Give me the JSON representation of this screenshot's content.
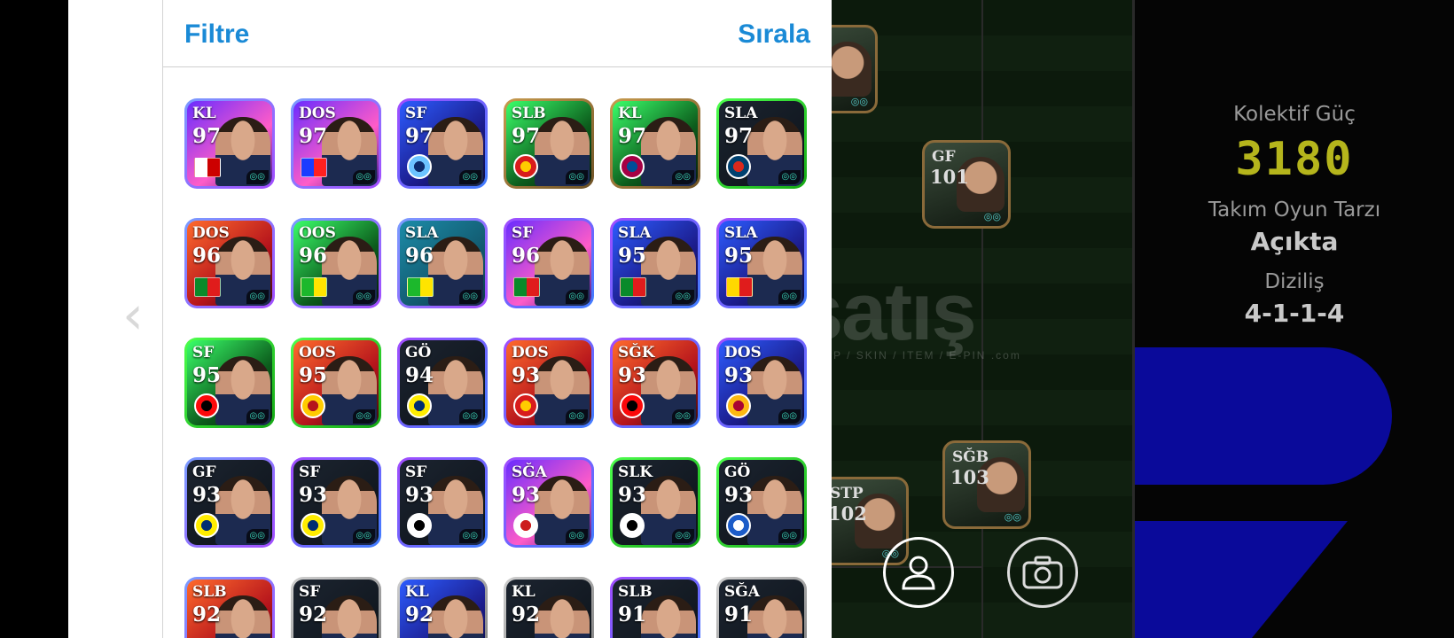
{
  "header": {
    "filter_label": "Filtre",
    "sort_label": "Sırala"
  },
  "squad_stats": {
    "collective_power_label": "Kolektif Güç",
    "collective_power_value": "3180",
    "play_style_label": "Takım Oyun Tarzı",
    "play_style_value": "Açıkta",
    "formation_label": "Diziliş",
    "formation_value": "4-1-1-4"
  },
  "watermark": {
    "text": "satış",
    "sub": "SAP / SKIN / ITEM / E-PIN",
    "domain": ".com"
  },
  "pitch_cards": [
    {
      "pos": "GF",
      "rating": "101"
    },
    {
      "pos": "SĞB",
      "rating": "103"
    },
    {
      "pos": "STP",
      "rating": "102"
    },
    {
      "pos": "",
      "rating": ""
    }
  ],
  "players": [
    {
      "pos": "KL",
      "rating": "97",
      "frame": "blue",
      "bg": "purple",
      "badge": "flag",
      "badge_color": "#ffffff",
      "badge_stripe": "#cc0000"
    },
    {
      "pos": "DOS",
      "rating": "97",
      "frame": "blue",
      "bg": "purple",
      "badge": "flag",
      "badge_color": "#1a3cff",
      "badge_stripe": "#ff2020"
    },
    {
      "pos": "SF",
      "rating": "97",
      "frame": "purple",
      "bg": "blue",
      "badge": "crest",
      "badge_color": "#6cc4ff",
      "badge_stripe": "#0c2c6c"
    },
    {
      "pos": "SLB",
      "rating": "97",
      "frame": "gold",
      "bg": "green",
      "badge": "crest",
      "badge_color": "#d81c1c",
      "badge_stripe": "#ffcc00"
    },
    {
      "pos": "KL",
      "rating": "97",
      "frame": "gold",
      "bg": "green",
      "badge": "crest",
      "badge_color": "#a50044",
      "badge_stripe": "#004d98"
    },
    {
      "pos": "SLA",
      "rating": "97",
      "frame": "green",
      "bg": "dark",
      "badge": "crest",
      "badge_color": "#004170",
      "badge_stripe": "#da291c"
    },
    {
      "pos": "DOS",
      "rating": "96",
      "frame": "blue",
      "bg": "red",
      "badge": "flag",
      "badge_color": "#0a8a2a",
      "badge_stripe": "#e01c1c"
    },
    {
      "pos": "OOS",
      "rating": "96",
      "frame": "blue",
      "bg": "green",
      "badge": "flag",
      "badge_color": "#1cb82c",
      "badge_stripe": "#ffe400"
    },
    {
      "pos": "SLA",
      "rating": "96",
      "frame": "blue",
      "bg": "teal",
      "badge": "flag",
      "badge_color": "#1cb82c",
      "badge_stripe": "#ffe400"
    },
    {
      "pos": "SF",
      "rating": "96",
      "frame": "purple",
      "bg": "purple",
      "badge": "flag",
      "badge_color": "#0a8a2a",
      "badge_stripe": "#e01c1c"
    },
    {
      "pos": "SLA",
      "rating": "95",
      "frame": "purple",
      "bg": "blue",
      "badge": "flag",
      "badge_color": "#0a8a2a",
      "badge_stripe": "#e01c1c"
    },
    {
      "pos": "SLA",
      "rating": "95",
      "frame": "purple",
      "bg": "blue",
      "badge": "flag",
      "badge_color": "#ffd800",
      "badge_stripe": "#e01c1c"
    },
    {
      "pos": "SF",
      "rating": "95",
      "frame": "green",
      "bg": "green",
      "badge": "crest",
      "badge_color": "#fb090b",
      "badge_stripe": "#000000"
    },
    {
      "pos": "OOS",
      "rating": "95",
      "frame": "green",
      "bg": "red",
      "badge": "crest",
      "badge_color": "#ffcc00",
      "badge_stripe": "#b5141c"
    },
    {
      "pos": "GÖ",
      "rating": "94",
      "frame": "purple",
      "bg": "dark",
      "badge": "crest",
      "badge_color": "#ffed00",
      "badge_stripe": "#002d72"
    },
    {
      "pos": "DOS",
      "rating": "93",
      "frame": "purple",
      "bg": "red",
      "badge": "crest",
      "badge_color": "#d81c1c",
      "badge_stripe": "#ffcc00"
    },
    {
      "pos": "SĞK",
      "rating": "93",
      "frame": "purple",
      "bg": "red",
      "badge": "crest",
      "badge_color": "#fb090b",
      "badge_stripe": "#000000"
    },
    {
      "pos": "DOS",
      "rating": "93",
      "frame": "purple",
      "bg": "blue",
      "badge": "crest",
      "badge_color": "#fdb912",
      "badge_stripe": "#a90432"
    },
    {
      "pos": "GF",
      "rating": "93",
      "frame": "blue",
      "bg": "dark",
      "badge": "crest",
      "badge_color": "#ffed00",
      "badge_stripe": "#002d72"
    },
    {
      "pos": "SF",
      "rating": "93",
      "frame": "purple",
      "bg": "dark",
      "badge": "crest",
      "badge_color": "#ffed00",
      "badge_stripe": "#002d72"
    },
    {
      "pos": "SF",
      "rating": "93",
      "frame": "purple",
      "bg": "dark",
      "badge": "crest",
      "badge_color": "#ffffff",
      "badge_stripe": "#000000"
    },
    {
      "pos": "SĞA",
      "rating": "93",
      "frame": "purple",
      "bg": "purple",
      "badge": "crest",
      "badge_color": "#ffffff",
      "badge_stripe": "#cc1c1c"
    },
    {
      "pos": "SLK",
      "rating": "93",
      "frame": "green",
      "bg": "dark",
      "badge": "crest",
      "badge_color": "#ffffff",
      "badge_stripe": "#000000"
    },
    {
      "pos": "GÖ",
      "rating": "93",
      "frame": "green",
      "bg": "dark",
      "badge": "crest",
      "badge_color": "#1c5cc8",
      "badge_stripe": "#ffffff"
    },
    {
      "pos": "SLB",
      "rating": "92",
      "frame": "blue",
      "bg": "red",
      "badge": "none",
      "badge_color": "#cc1c1c",
      "badge_stripe": "#ffffff"
    },
    {
      "pos": "SF",
      "rating": "92",
      "frame": "silver",
      "bg": "dark",
      "badge": "none",
      "badge_color": "#ffcc00",
      "badge_stripe": "#000000"
    },
    {
      "pos": "KL",
      "rating": "92",
      "frame": "silver",
      "bg": "blue",
      "badge": "none",
      "badge_color": "#ffffff",
      "badge_stripe": "#000000"
    },
    {
      "pos": "KL",
      "rating": "92",
      "frame": "silver",
      "bg": "dark",
      "badge": "none",
      "badge_color": "#ffffff",
      "badge_stripe": "#000000"
    },
    {
      "pos": "SLB",
      "rating": "91",
      "frame": "purple",
      "bg": "dark",
      "badge": "none",
      "badge_color": "#ffffff",
      "badge_stripe": "#000000"
    },
    {
      "pos": "SĞA",
      "rating": "91",
      "frame": "silver",
      "bg": "dark",
      "badge": "none",
      "badge_color": "#ffffff",
      "badge_stripe": "#000000"
    }
  ]
}
